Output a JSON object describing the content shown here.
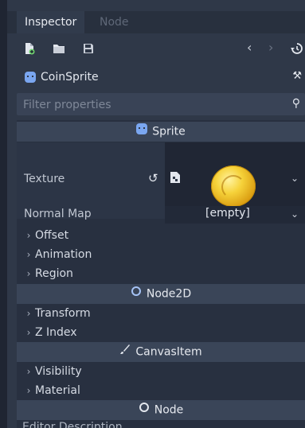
{
  "tabs": {
    "inspector": "Inspector",
    "node": "Node"
  },
  "object": {
    "name": "CoinSprite"
  },
  "filter": {
    "placeholder": "Filter properties"
  },
  "sections": {
    "sprite": "Sprite",
    "node2d": "Node2D",
    "canvasitem": "CanvasItem",
    "node": "Node"
  },
  "properties": {
    "texture": "Texture",
    "normal_map": "Normal Map",
    "normal_map_value": "[empty]"
  },
  "groups": {
    "offset": "Offset",
    "animation": "Animation",
    "region": "Region",
    "transform": "Transform",
    "z_index": "Z Index",
    "visibility": "Visibility",
    "material": "Material"
  },
  "cutoff_text": "Editor Description",
  "icons": {
    "new_script": "new-resource-icon",
    "open": "folder-icon",
    "save": "save-icon",
    "back": "chevron-left-icon",
    "forward": "chevron-right-icon",
    "history": "history-icon",
    "node_type": "sprite-node-icon",
    "tools": "tools-icon",
    "search": "search-icon"
  },
  "colors": {
    "accent_blue": "#7aa6f0",
    "panel_bg": "#2f3848",
    "header_bg": "#3a4558",
    "coin": "#f6d23a"
  }
}
